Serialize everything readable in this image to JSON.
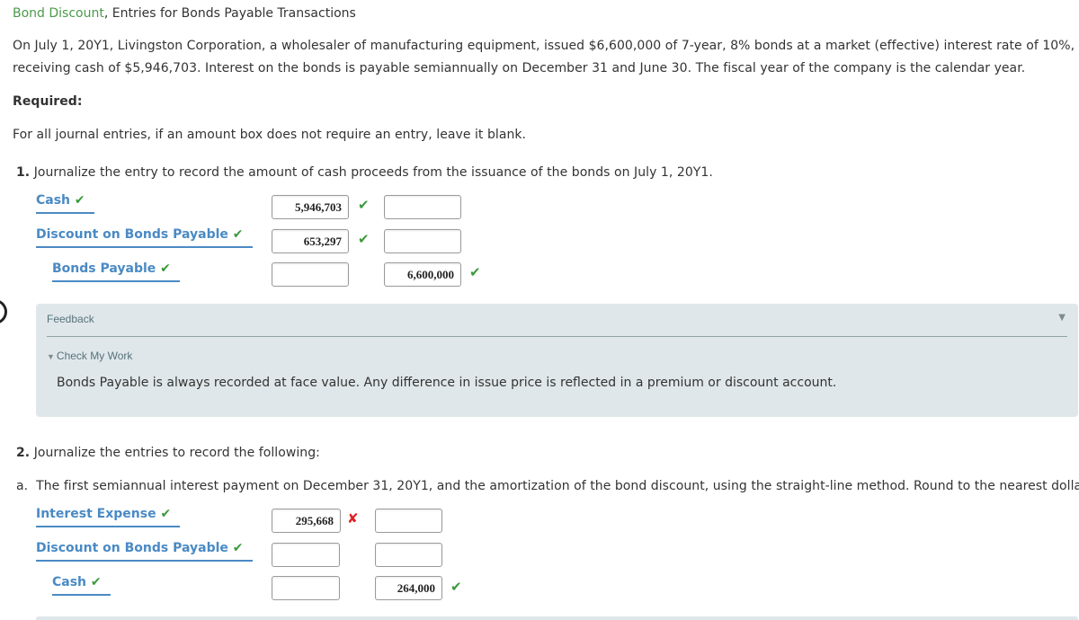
{
  "header": {
    "title_link": "Bond Discount",
    "title_rest": ", Entries for Bonds Payable Transactions"
  },
  "problem": {
    "line1": "On July 1, 20Y1, Livingston Corporation, a wholesaler of manufacturing equipment, issued $6,600,000 of 7-year, 8% bonds at a market (effective) interest rate of 10%,",
    "line2": "receiving cash of $5,946,703. Interest on the bonds is payable semiannually on December 31 and June 30. The fiscal year of the company is the calendar year.",
    "required_label": "Required:",
    "instruction": "For all journal entries, if an amount box does not require an entry, leave it blank."
  },
  "q1": {
    "number": "1.",
    "text": "Journalize the entry to record the amount of cash proceeds from the issuance of the bonds on July 1, 20Y1.",
    "rows": [
      {
        "account": "Cash",
        "account_status": "correct",
        "debit": "5,946,703",
        "debit_status": "correct",
        "credit": "",
        "credit_status": ""
      },
      {
        "account": "Discount on Bonds Payable",
        "account_status": "correct",
        "debit": "653,297",
        "debit_status": "correct",
        "credit": "",
        "credit_status": ""
      },
      {
        "account": "Bonds Payable",
        "account_status": "correct",
        "debit": "",
        "debit_status": "",
        "credit": "6,600,000",
        "credit_status": "correct"
      }
    ]
  },
  "feedback": {
    "header": "Feedback",
    "check_my_work": "Check My Work",
    "text": "Bonds Payable is always recorded at face value. Any difference in issue price is reflected in a premium or discount account."
  },
  "q2": {
    "number": "2.",
    "text": "Journalize the entries to record the following:",
    "part_a": "a.  The first semiannual interest payment on December 31, 20Y1, and the amortization of the bond discount, using the straight-line method. Round to the nearest dollar.",
    "rows": [
      {
        "account": "Interest Expense",
        "account_status": "correct",
        "debit": "295,668",
        "debit_status": "incorrect",
        "credit": "",
        "credit_status": ""
      },
      {
        "account": "Discount on Bonds Payable",
        "account_status": "correct",
        "debit": "",
        "debit_status": "",
        "credit": "",
        "credit_status": ""
      },
      {
        "account": "Cash",
        "account_status": "correct",
        "debit": "",
        "debit_status": "",
        "credit": "264,000",
        "credit_status": "correct"
      }
    ]
  },
  "icons": {
    "check": "✔",
    "cross": "✘",
    "down_triangle": "▼"
  },
  "colors": {
    "link_green": "#4a9a4a",
    "account_blue": "#4a8ac4",
    "check_green": "#3a9a3a",
    "error_red": "#e02020",
    "feedback_bg": "#e0e7ea"
  }
}
